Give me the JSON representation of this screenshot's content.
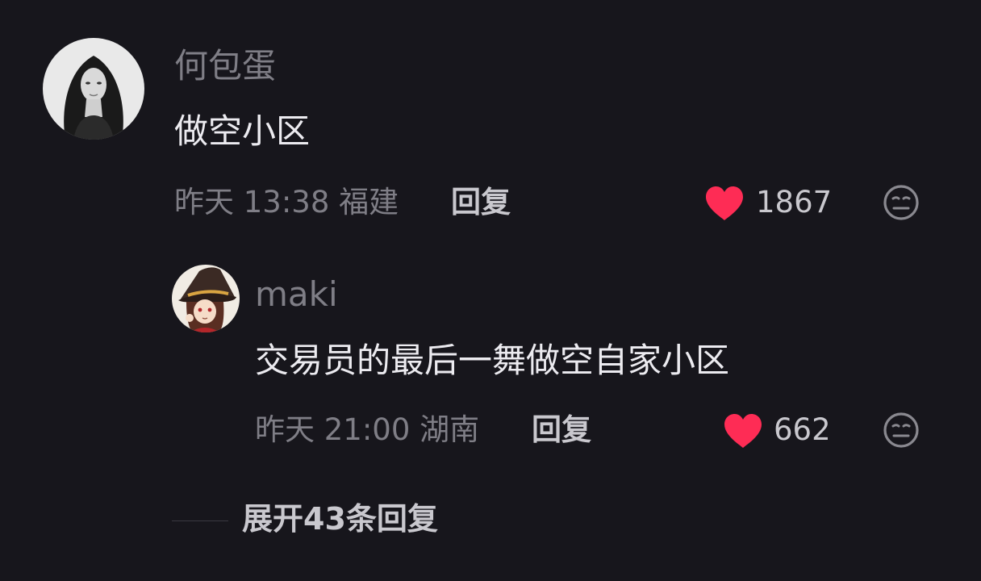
{
  "comment": {
    "username": "何包蛋",
    "text": "做空小区",
    "meta": "昨天 13:38 福建",
    "reply_label": "回复",
    "likes": "1867"
  },
  "reply": {
    "username": "maki",
    "text": "交易员的最后一舞做空自家小区",
    "meta": "昨天 21:00 湖南",
    "reply_label": "回复",
    "likes": "662"
  },
  "expand_label": "展开43条回复",
  "colors": {
    "background": "#17161c",
    "like_red": "#fe2c55",
    "muted_text": "#7f7e86",
    "primary_text": "#ecebf0"
  },
  "icons": {
    "like": "heart-icon",
    "dislike": "unamused-face-icon"
  }
}
